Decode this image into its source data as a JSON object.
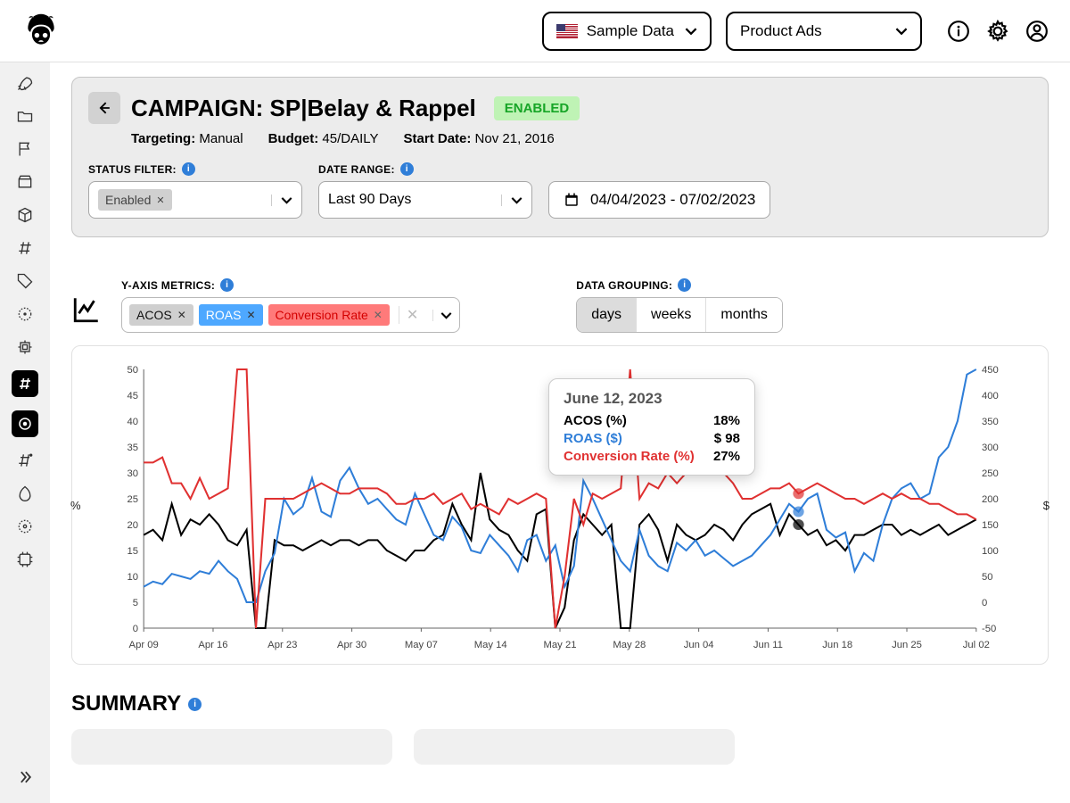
{
  "topbar": {
    "data_select": "Sample Data",
    "product_select": "Product Ads"
  },
  "header": {
    "title": "CAMPAIGN: SP|Belay & Rappel",
    "status_badge": "ENABLED",
    "targeting_label": "Targeting:",
    "targeting_value": "Manual",
    "budget_label": "Budget:",
    "budget_value": "45/DAILY",
    "start_label": "Start Date:",
    "start_value": "Nov 21, 2016"
  },
  "filters": {
    "status_label": "STATUS FILTER:",
    "status_chip": "Enabled",
    "daterange_label": "DATE RANGE:",
    "daterange_value": "Last 90 Days",
    "daterange_dates": "04/04/2023 - 07/02/2023"
  },
  "metrics": {
    "label": "Y-AXIS METRICS:",
    "chips": {
      "acos": "ACOS",
      "roas": "ROAS",
      "conv": "Conversion Rate"
    }
  },
  "grouping": {
    "label": "DATA GROUPING:",
    "options": {
      "days": "days",
      "weeks": "weeks",
      "months": "months"
    },
    "active": "days"
  },
  "tooltip": {
    "date": "June 12, 2023",
    "rows": {
      "acos_label": "ACOS (%)",
      "acos_value": "18%",
      "roas_label": "ROAS ($)",
      "roas_value": "$ 98",
      "conv_label": "Conversion Rate (%)",
      "conv_value": "27%"
    }
  },
  "summary": {
    "title": "SUMMARY"
  },
  "chart_data": {
    "type": "line",
    "x_ticks": [
      "Apr 09",
      "Apr 16",
      "Apr 23",
      "Apr 30",
      "May 07",
      "May 14",
      "May 21",
      "May 28",
      "Jun 04",
      "Jun 11",
      "Jun 18",
      "Jun 25",
      "Jul 02"
    ],
    "left_axis": {
      "label": "%",
      "min": 0,
      "max": 50,
      "ticks": [
        0,
        5,
        10,
        15,
        20,
        25,
        30,
        35,
        40,
        45,
        50
      ]
    },
    "right_axis": {
      "label": "$",
      "min": -50,
      "max": 450,
      "ticks": [
        -50,
        0,
        50,
        100,
        150,
        200,
        250,
        300,
        350,
        400,
        450
      ]
    },
    "series": [
      {
        "name": "ACOS",
        "color": "#000000",
        "axis": "left",
        "values": [
          18,
          19,
          17,
          24,
          18,
          21,
          20,
          22,
          20,
          17,
          16,
          19,
          0,
          0,
          17,
          16,
          16,
          15,
          16,
          17,
          16,
          17,
          17,
          16,
          17,
          17,
          15,
          14,
          13,
          15,
          15,
          17,
          18,
          24,
          20,
          17,
          30,
          21,
          19,
          18,
          15,
          13,
          22,
          23,
          0,
          4,
          17,
          22,
          20,
          18,
          20,
          0,
          0,
          20,
          22,
          19,
          13,
          20,
          18,
          17,
          18,
          20,
          19,
          17,
          20,
          22,
          23,
          24,
          18,
          22,
          20,
          18,
          19,
          16,
          17,
          15,
          18,
          18,
          19,
          20,
          20,
          18,
          19,
          18,
          19,
          20,
          18,
          19,
          20,
          21
        ]
      },
      {
        "name": "ROAS",
        "color": "#2f7ed8",
        "axis": "right",
        "values": [
          30,
          40,
          35,
          55,
          50,
          45,
          60,
          55,
          80,
          60,
          45,
          0,
          0,
          60,
          95,
          200,
          170,
          185,
          240,
          175,
          165,
          235,
          260,
          220,
          190,
          200,
          180,
          160,
          150,
          210,
          170,
          130,
          120,
          165,
          145,
          100,
          95,
          130,
          110,
          90,
          60,
          120,
          130,
          80,
          110,
          30,
          70,
          235,
          200,
          160,
          120,
          80,
          60,
          140,
          90,
          70,
          60,
          115,
          100,
          120,
          90,
          100,
          85,
          70,
          80,
          90,
          110,
          130,
          160,
          190,
          175,
          200,
          210,
          140,
          125,
          135,
          60,
          95,
          80,
          150,
          200,
          220,
          230,
          200,
          210,
          280,
          300,
          350,
          440,
          450
        ]
      },
      {
        "name": "Conversion Rate",
        "color": "#e03131",
        "axis": "left",
        "values": [
          32,
          32,
          33,
          28,
          28,
          25,
          29,
          25,
          26,
          27,
          50,
          50,
          0,
          25,
          25,
          25,
          25,
          26,
          27,
          28,
          27,
          26,
          26,
          27,
          27,
          27,
          26,
          24,
          24,
          25,
          25,
          26,
          24,
          25,
          26,
          23,
          24,
          23,
          22,
          25,
          24,
          25,
          26,
          25,
          0,
          10,
          25,
          20,
          26,
          25,
          26,
          27,
          50,
          25,
          28,
          27,
          30,
          28,
          30,
          30,
          32,
          31,
          30,
          28,
          25,
          25,
          26,
          27,
          27,
          28,
          26,
          27,
          28,
          27,
          26,
          25,
          25,
          24,
          25,
          26,
          25,
          26,
          25,
          25,
          24,
          24,
          23,
          22,
          22,
          21
        ]
      }
    ],
    "highlight_index": 70
  }
}
